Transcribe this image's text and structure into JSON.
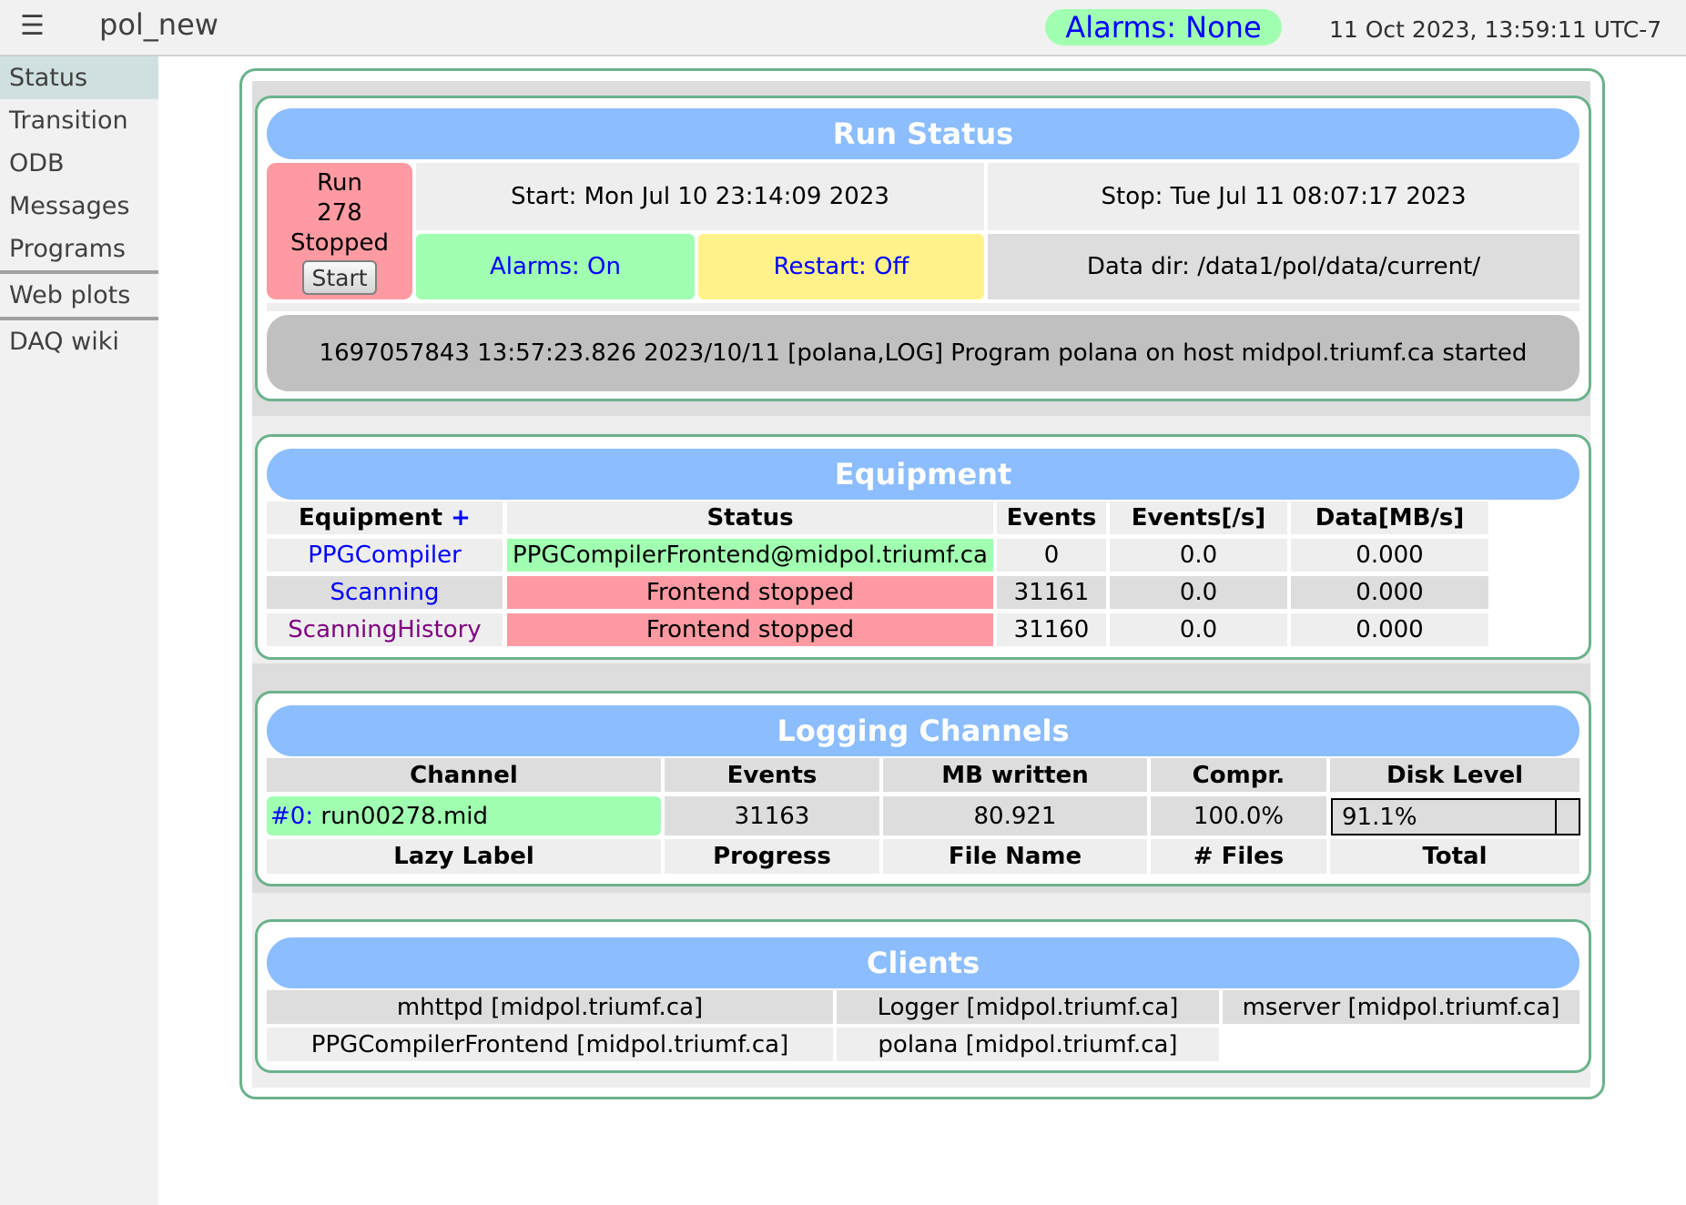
{
  "header": {
    "menu_icon": "hamburger-menu-icon",
    "experiment": "pol_new",
    "alarms_badge": "Alarms: None",
    "clock": "11 Oct 2023, 13:59:11 UTC-7"
  },
  "sidebar": {
    "items": [
      {
        "label": "Status",
        "active": true
      },
      {
        "label": "Transition"
      },
      {
        "label": "ODB"
      },
      {
        "label": "Messages"
      },
      {
        "label": "Programs"
      },
      {
        "label": "Web plots"
      },
      {
        "label": "DAQ wiki"
      }
    ]
  },
  "colors": {
    "accent_title": "#8cbdff",
    "box_border": "#6bb28c",
    "ok_green": "#a0ffb0",
    "stopped_red": "#ff9aa2",
    "warn_yellow": "#fff28a"
  },
  "run_status": {
    "title": "Run Status",
    "run_label": "Run",
    "run_number": "278",
    "state": "Stopped",
    "start_button": "Start",
    "start_time": "Start: Mon Jul 10 23:14:09 2023",
    "stop_time": "Stop: Tue Jul 11 08:07:17 2023",
    "alarms": "Alarms: On",
    "restart": "Restart: Off",
    "data_dir": "Data dir: /data1/pol/data/current/",
    "last_message": "1697057843 13:57:23.826 2023/10/11 [polana,LOG] Program polana on host midpol.triumf.ca started"
  },
  "equipment": {
    "title": "Equipment",
    "columns": [
      "Equipment",
      "Status",
      "Events",
      "Events[/s]",
      "Data[MB/s]"
    ],
    "add_symbol": "+",
    "rows": [
      {
        "name": "PPGCompiler",
        "status": "PPGCompilerFrontend@midpol.triumf.ca",
        "events": "0",
        "rate": "0.0",
        "data": "0.000"
      },
      {
        "name": "Scanning",
        "status": "Frontend stopped",
        "events": "31161",
        "rate": "0.0",
        "data": "0.000"
      },
      {
        "name": "ScanningHistory",
        "status": "Frontend stopped",
        "events": "31160",
        "rate": "0.0",
        "data": "0.000"
      }
    ]
  },
  "logging": {
    "title": "Logging Channels",
    "columns": [
      "Channel",
      "Events",
      "MB written",
      "Compr.",
      "Disk Level"
    ],
    "sub_columns": [
      "Lazy Label",
      "Progress",
      "File Name",
      "# Files",
      "Total"
    ],
    "rows": [
      {
        "channel_id": "#0:",
        "file": "run00278.mid",
        "events": "31163",
        "mb_written": "80.921",
        "compression": "100.0%",
        "disk_level": "91.1%",
        "disk_level_fraction": 0.911
      }
    ]
  },
  "clients": {
    "title": "Clients",
    "items": [
      "mhttpd [midpol.triumf.ca]",
      "Logger [midpol.triumf.ca]",
      "mserver [midpol.triumf.ca]",
      "PPGCompilerFrontend [midpol.triumf.ca]",
      "polana [midpol.triumf.ca]"
    ]
  }
}
